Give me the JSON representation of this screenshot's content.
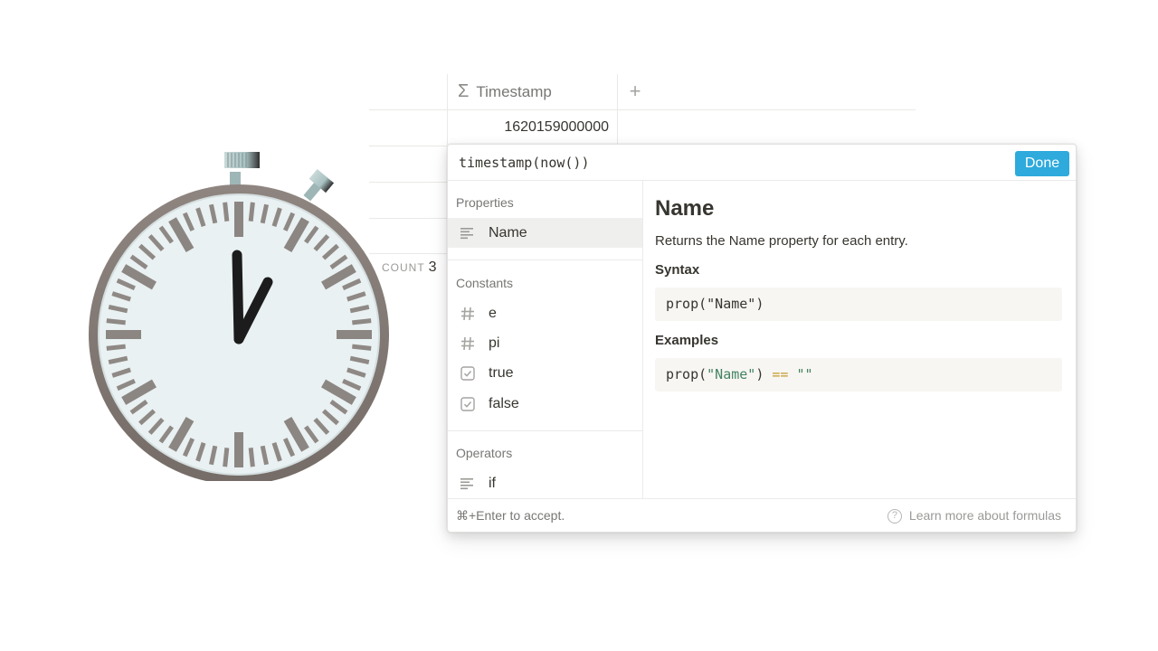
{
  "table": {
    "column_header": "Timestamp",
    "column_icon": "sigma-icon",
    "add_column": "+",
    "cell_value": "1620159000000",
    "count_label": "COUNT",
    "count_value": "3"
  },
  "popup": {
    "formula": "timestamp(now())",
    "done_label": "Done",
    "sections": {
      "properties": {
        "title": "Properties",
        "items": [
          {
            "label": "Name",
            "icon": "text-lines-icon",
            "selected": true
          }
        ]
      },
      "constants": {
        "title": "Constants",
        "items": [
          {
            "label": "e",
            "icon": "hash-icon"
          },
          {
            "label": "pi",
            "icon": "hash-icon"
          },
          {
            "label": "true",
            "icon": "checkbox-icon"
          },
          {
            "label": "false",
            "icon": "checkbox-icon"
          }
        ]
      },
      "operators": {
        "title": "Operators",
        "items": [
          {
            "label": "if",
            "icon": "text-lines-icon"
          }
        ]
      }
    },
    "doc": {
      "title": "Name",
      "description": "Returns the Name property for each entry.",
      "syntax_heading": "Syntax",
      "syntax_code": "prop(\"Name\")",
      "examples_heading": "Examples",
      "example": {
        "fn": "prop(",
        "arg": "\"Name\"",
        "close": ")",
        "op": "==",
        "empty": "\"\""
      }
    },
    "footer": {
      "hint": "⌘+Enter to accept.",
      "learn_more": "Learn more about formulas",
      "help_icon": "?"
    }
  },
  "colors": {
    "accent": "#2eaadc",
    "string": "#448361",
    "operator": "#c59a2a"
  }
}
